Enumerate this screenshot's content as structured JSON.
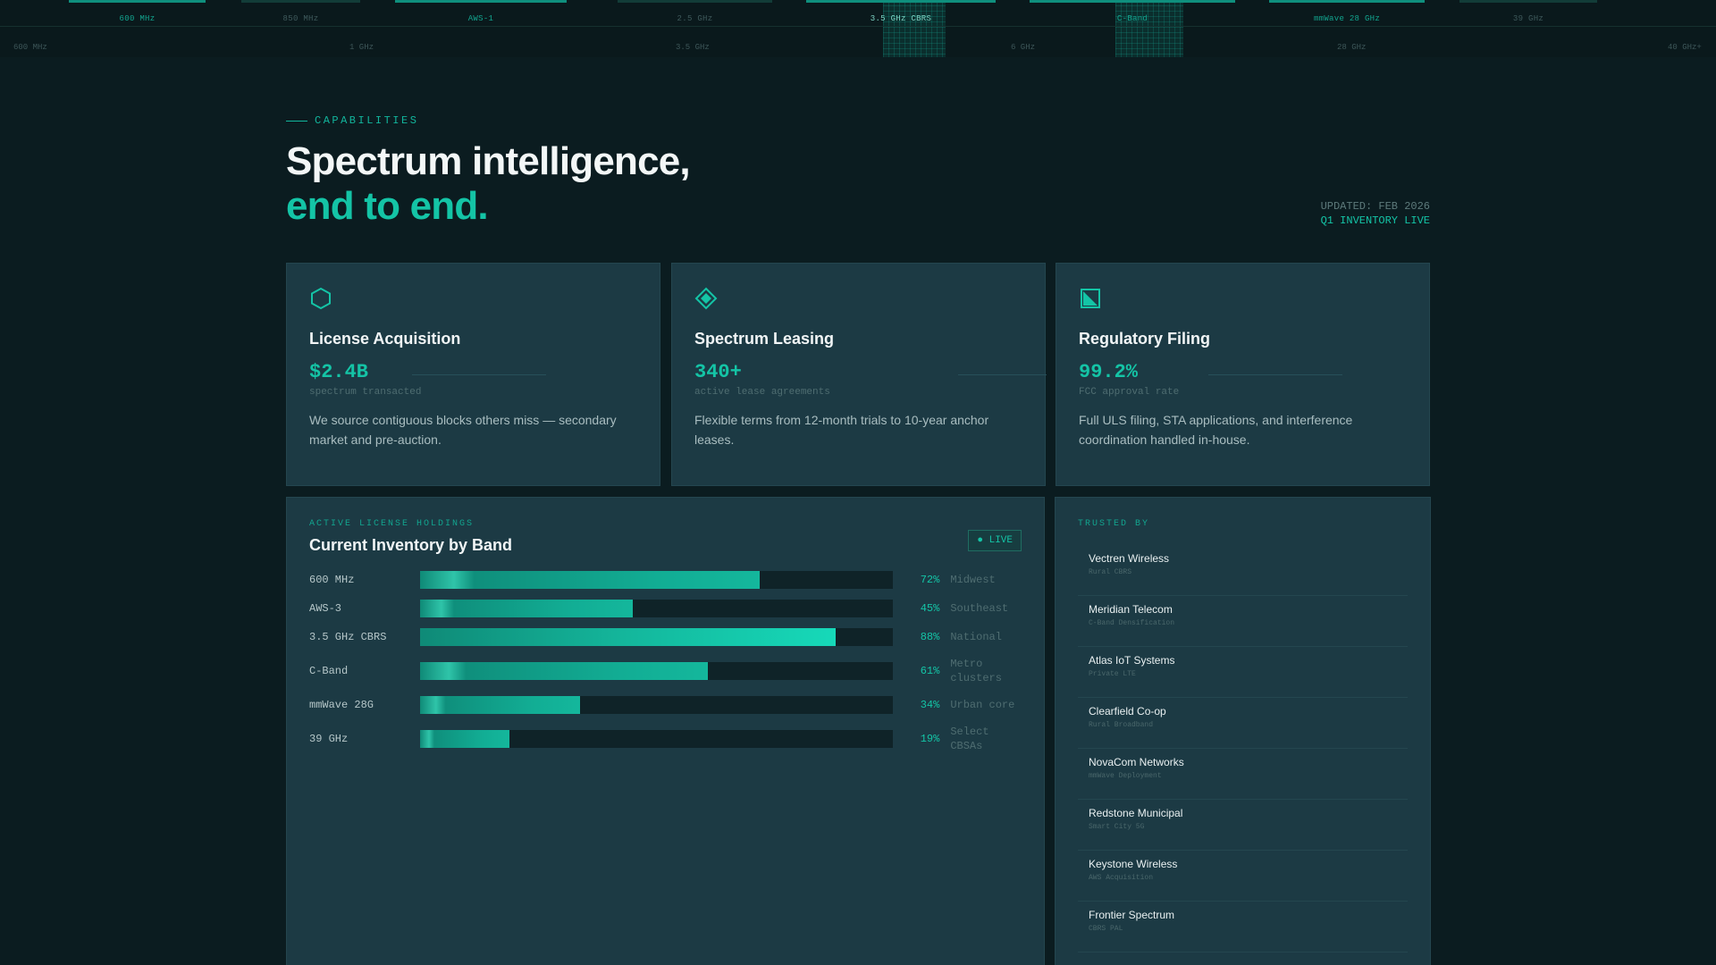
{
  "spectrum": {
    "bands": [
      {
        "label": "600 MHz",
        "active": true
      },
      {
        "label": "850 MHz",
        "active": false
      },
      {
        "label": "AWS-1",
        "active": true
      },
      {
        "label": "2.5 GHz",
        "active": false
      },
      {
        "label": "3.5 GHz CBRS",
        "active": true
      },
      {
        "label": "C-Band",
        "active": true
      },
      {
        "label": "mmWave 28 GHz",
        "active": true
      },
      {
        "label": "39 GHz",
        "active": false
      }
    ],
    "ticks": [
      "600 MHz",
      "1 GHz",
      "3.5 GHz",
      "6 GHz",
      "28 GHz",
      "40 GHz+"
    ]
  },
  "header": {
    "eyebrow": "CAPABILITIES",
    "title_line1": "Spectrum intelligence,",
    "title_line2": "end to end.",
    "updated": "UPDATED: FEB 2026",
    "status": "Q1 INVENTORY LIVE"
  },
  "cards": [
    {
      "icon": "hexagon-icon",
      "title": "License Acquisition",
      "stat": "$2.4B",
      "stat_label": "spectrum transacted",
      "desc": "We source contiguous blocks others miss — secondary market and pre-auction."
    },
    {
      "icon": "diamond-icon",
      "title": "Spectrum Leasing",
      "stat": "340+",
      "stat_label": "active lease agreements",
      "desc": "Flexible terms from 12-month trials to 10-year anchor leases."
    },
    {
      "icon": "document-icon",
      "title": "Regulatory Filing",
      "stat": "99.2%",
      "stat_label": "FCC approval rate",
      "desc": "Full ULS filing, STA applications, and interference coordination handled in-house."
    }
  ],
  "inventory": {
    "kicker": "ACTIVE LICENSE HOLDINGS",
    "title": "Current Inventory by Band",
    "live_label": "● LIVE",
    "rows": [
      {
        "band": "600 MHz",
        "pct_label": "72%",
        "value": 72,
        "region": "Midwest"
      },
      {
        "band": "AWS-3",
        "pct_label": "45%",
        "value": 45,
        "region": "Southeast"
      },
      {
        "band": "3.5 GHz CBRS",
        "pct_label": "88%",
        "value": 88,
        "region": "National"
      },
      {
        "band": "C-Band",
        "pct_label": "61%",
        "value": 61,
        "region": "Metro clusters"
      },
      {
        "band": "mmWave 28G",
        "pct_label": "34%",
        "value": 34,
        "region": "Urban core"
      },
      {
        "band": "39 GHz",
        "pct_label": "19%",
        "value": 19,
        "region": "Select CBSAs"
      }
    ]
  },
  "trusted": {
    "kicker": "TRUSTED BY",
    "clients": [
      {
        "name": "Vectren Wireless",
        "desc": "Rural CBRS"
      },
      {
        "name": "Meridian Telecom",
        "desc": "C-Band Densification"
      },
      {
        "name": "Atlas IoT Systems",
        "desc": "Private LTE"
      },
      {
        "name": "Clearfield Co-op",
        "desc": "Rural Broadband"
      },
      {
        "name": "NovaCom Networks",
        "desc": "mmWave Deployment"
      },
      {
        "name": "Redstone Municipal",
        "desc": "Smart City 5G"
      },
      {
        "name": "Keystone Wireless",
        "desc": "AWS Acquisition"
      },
      {
        "name": "Frontier Spectrum",
        "desc": "CBRS PAL"
      }
    ]
  },
  "colors": {
    "accent": "#14c4a6",
    "background": "#0b1c20",
    "card": "#1c3a44"
  }
}
